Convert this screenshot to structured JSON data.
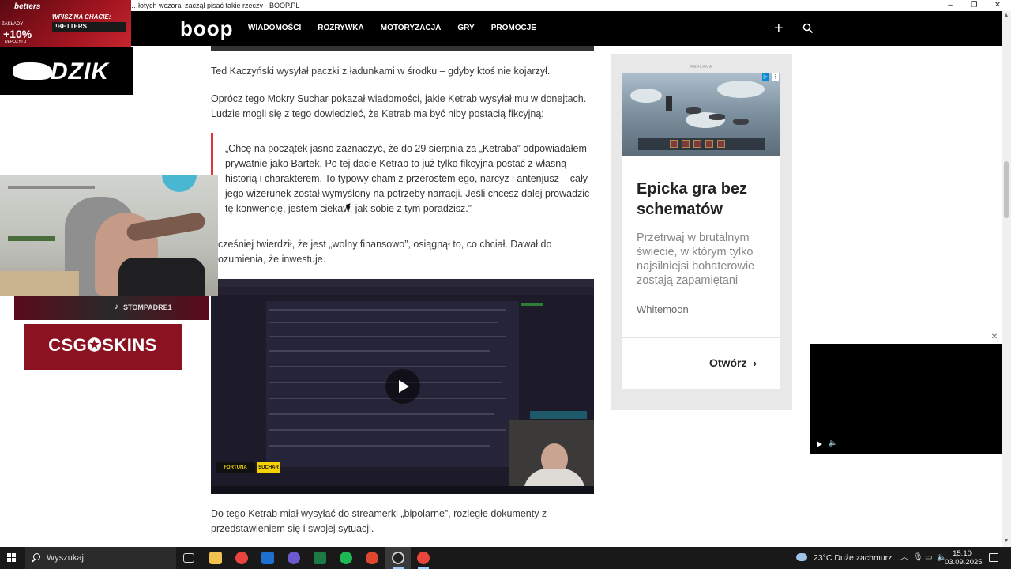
{
  "window": {
    "title": "…łotych wczoraj zaczął pisać takie rzeczy - BOOP.PL",
    "minimize": "–",
    "restore": "❐",
    "close": "✕"
  },
  "site": {
    "logo": "boop",
    "nav": [
      "WIADOMOŚCI",
      "ROZRYWKA",
      "MOTORYZACJA",
      "GRY",
      "PROMOCJE"
    ],
    "plus_icon": "plus-icon",
    "search_icon": "search-icon"
  },
  "article": {
    "p1": "Ted Kaczyński wysyłał paczki z ładunkami w środku – gdyby ktoś nie kojarzył.",
    "p2": "Oprócz tego Mokry Suchar pokazał wiadomości, jakie Ketrab wysyłał mu w donejtach. Ludzie mogli się z tego dowiedzieć, że Ketrab ma być niby postacią fikcyjną:",
    "quote": "„Chcę na początek jasno zaznaczyć, że do 29 sierpnia za „Ketraba” odpowiadałem prywatnie jako Bartek. Po tej dacie Ketrab to już tylko fikcyjna postać z własną historią i charakterem. To typowy cham z przerostem ego, narcyz i antenjusz – cały jego wizerunek został wymyślony na potrzeby narracji. Jeśli chcesz dalej prowadzić tę konwencję, jestem ciekaw, jak sobie z tym poradzisz.”",
    "p3": "cześniej twierdził, że jest „wolny finansowo”, osiągnął to, co chciał. Dawał do ozumienia, że inwestuje.",
    "video_brand": "FORTUNA",
    "video_brand2": "SUCHAR",
    "p4": "Do tego Ketrab miał wysyłać do streamerki „bipolarne”, rozległe dokumenty z przedstawieniem się i swojej sytuacji."
  },
  "ad": {
    "label": "REKLAMA",
    "headline": "Epicka gra bez schematów",
    "text": "Przetrwaj w brutalnym świecie, w którym tylko najsilniejsi bohaterowie zostają zapamiętani",
    "brand": "Whitemoon",
    "cta": "Otwórz",
    "cta_icon": "chevron-right-icon",
    "info_icon": "ad-info-icon",
    "close_icon": "ad-close-icon"
  },
  "overlays": {
    "betters_logo": "betters",
    "betters_small": "ZAKŁADY",
    "betters_percent": "+10%",
    "betters_deposit": "DEPOZYTU",
    "betters_slogan": "WPISZ NA CHACIE:",
    "betters_code": "!BETTERS",
    "dzik": "DZIK",
    "tiktok": "STOMPADRE1",
    "csg": "CSG✪SKINS"
  },
  "float_player": {
    "close": "✕",
    "play_icon": "play-icon",
    "volume_icon": "volume-icon"
  },
  "taskbar": {
    "search_placeholder": "Wyszukaj",
    "weather": "23°C  Duże zachmurz…",
    "time": "15:10",
    "date": "03.09.2025"
  }
}
